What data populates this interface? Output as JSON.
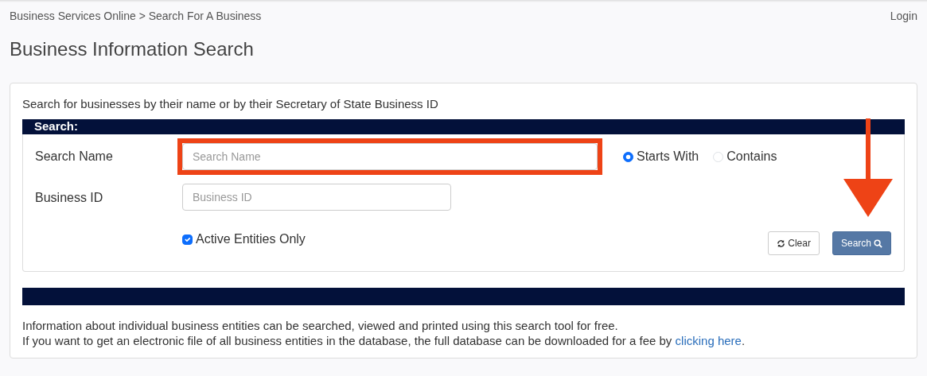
{
  "breadcrumb": "Business Services Online > Search For A Business",
  "login": "Login",
  "title": "Business Information Search",
  "intro": "Search for businesses by their name or by their Secretary of State Business ID",
  "search_panel": {
    "header": "Search:",
    "fields": [
      {
        "label": "Search Name",
        "placeholder": "Search Name",
        "highlighted": true
      },
      {
        "label": "Business ID",
        "placeholder": "Business ID",
        "highlighted": false
      }
    ],
    "match_options": [
      {
        "label": "Starts With",
        "selected": true
      },
      {
        "label": "Contains",
        "selected": false
      }
    ],
    "active_only": {
      "label": "Active Entities Only",
      "checked": true
    },
    "buttons": [
      {
        "label": "Clear",
        "kind": "clear",
        "highlighted": false
      },
      {
        "label": "Search",
        "kind": "search",
        "highlighted": true
      }
    ]
  },
  "info_lines": [
    {
      "text": "Information about individual business entities can be searched, viewed and printed using this search tool for free."
    },
    {
      "text": "If you want to get an electronic file of all business entities in the database, the full database can be downloaded for a fee by ",
      "link": "clicking here",
      "after": "."
    }
  ]
}
